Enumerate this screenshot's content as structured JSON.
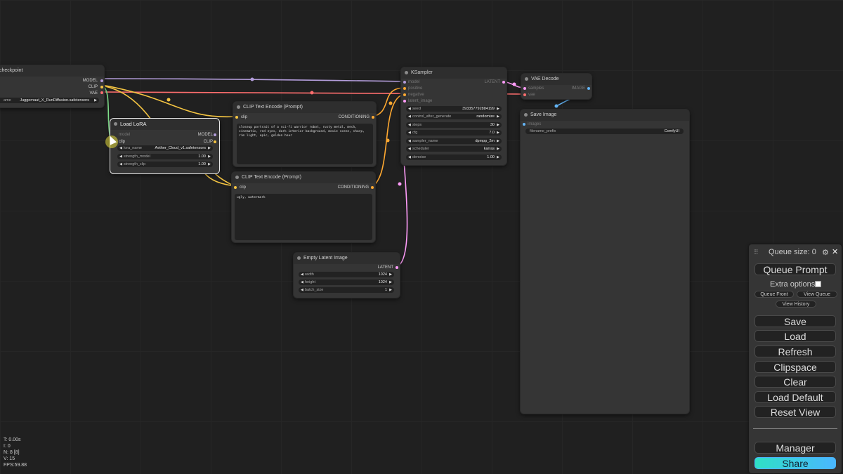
{
  "nodes": {
    "checkpoint": {
      "title": "checkpoint",
      "outputs": [
        "MODEL",
        "CLIP",
        "VAE"
      ],
      "ckpt_label": "ame",
      "ckpt_value": "Juggernaut_X_RunDiffusion.safetensors"
    },
    "lora": {
      "title": "Load LoRA",
      "inputs": [
        "model",
        "clip"
      ],
      "outputs": [
        "MODEL",
        "CLIP"
      ],
      "widgets": [
        {
          "label": "lora_name",
          "value": "Aether_Cloud_v1.safetensors"
        },
        {
          "label": "strength_model",
          "value": "1.00"
        },
        {
          "label": "strength_clip",
          "value": "1.00"
        }
      ]
    },
    "clip_pos": {
      "title": "CLIP Text Encode (Prompt)",
      "input": "clip",
      "output": "CONDITIONING",
      "text": "closeup portrait of a sci-fi warrior robot, rusty metal, mech, cinematic, red eyes, dark interior background, movie scene, sharp, rim light, epic, golden hour"
    },
    "clip_neg": {
      "title": "CLIP Text Encode (Prompt)",
      "input": "clip",
      "output": "CONDITIONING",
      "text": "ugly, watermark"
    },
    "latent": {
      "title": "Empty Latent Image",
      "output": "LATENT",
      "widgets": [
        {
          "label": "width",
          "value": "1024"
        },
        {
          "label": "height",
          "value": "1024"
        },
        {
          "label": "batch_size",
          "value": "1"
        }
      ]
    },
    "ksampler": {
      "title": "KSampler",
      "inputs": [
        "model",
        "positive",
        "negative",
        "latent_image"
      ],
      "output": "LATENT",
      "widgets": [
        {
          "label": "seed",
          "value": "393357792884199"
        },
        {
          "label": "control_after_generate",
          "value": "randomize"
        },
        {
          "label": "steps",
          "value": "30"
        },
        {
          "label": "cfg",
          "value": "7.0"
        },
        {
          "label": "sampler_name",
          "value": "dpmpp_2m"
        },
        {
          "label": "scheduler",
          "value": "karras"
        },
        {
          "label": "denoise",
          "value": "1.00"
        }
      ]
    },
    "vae_decode": {
      "title": "VAE Decode",
      "inputs": [
        "samples",
        "vae"
      ],
      "output": "IMAGE"
    },
    "save_image": {
      "title": "Save Image",
      "input": "images",
      "widget": {
        "label": "filename_prefix",
        "value": "ComfyUI"
      }
    }
  },
  "queue_panel": {
    "queue_size": "Queue size: 0",
    "queue_prompt": "Queue Prompt",
    "extra_options": "Extra options",
    "queue_front": "Queue Front",
    "view_queue": "View Queue",
    "view_history": "View History",
    "save": "Save",
    "load": "Load",
    "refresh": "Refresh",
    "clipspace": "Clipspace",
    "clear": "Clear",
    "load_default": "Load Default",
    "reset_view": "Reset View",
    "manager": "Manager",
    "share": "Share"
  },
  "stats": {
    "t": "T: 0.00s",
    "i": "I: 0",
    "n": "N: 8 [8]",
    "v": "V: 15",
    "fps": "FPS:59.88"
  },
  "colors": {
    "model_wire": "#b39ddb",
    "clip_wire": "#f5c542",
    "vae_wire": "#ff6e6e",
    "conditioning_wire": "#ffa931",
    "latent_wire": "#ff9cf9",
    "image_wire": "#64b5f6"
  }
}
